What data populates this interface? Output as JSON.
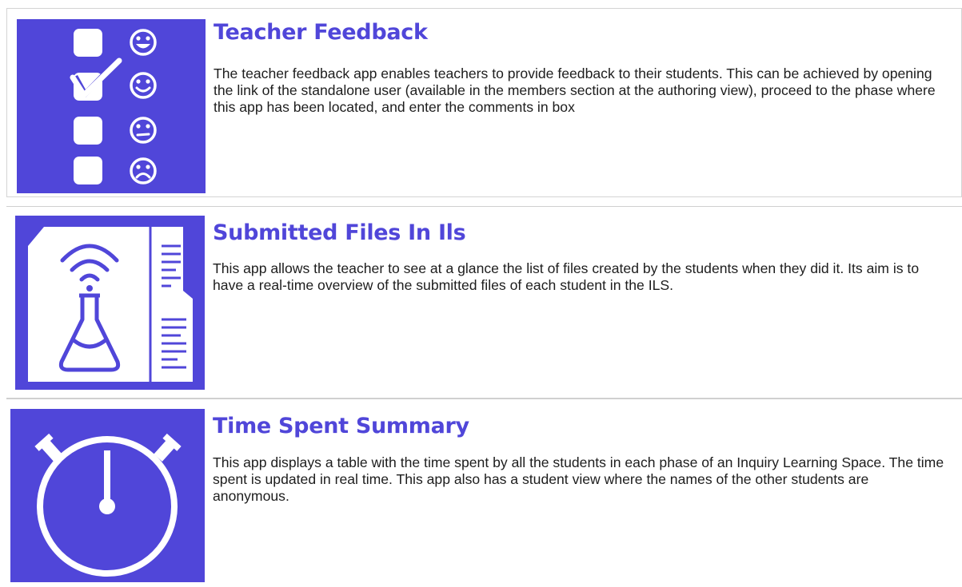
{
  "apps": [
    {
      "title": "Teacher Feedback",
      "description": "The teacher feedback app enables teachers to provide feedback to their students. This can be achieved by opening the link of the standalone user (available in the members section at the authoring view), proceed to the phase where this app has been located, and enter the comments in box",
      "icon": "feedback-checklist-icon"
    },
    {
      "title": "Submitted Files In Ils",
      "description": "This app allows the teacher to see at a glance the list of files created by the students when they did it. Its aim is to have a real-time overview of the submitted files of each student in the ILS.",
      "icon": "lab-flask-document-icon"
    },
    {
      "title": "Time Spent Summary",
      "description": "This app displays a table with the time spent by all the students in each phase of an Inquiry Learning Space. The time spent is updated in real time. This app also has a student view where the names of the other students are anonymous.",
      "icon": "stopwatch-icon"
    }
  ],
  "colors": {
    "accent": "#5046d9",
    "text": "#1d1d1d",
    "divider": "#d4d4d4"
  }
}
